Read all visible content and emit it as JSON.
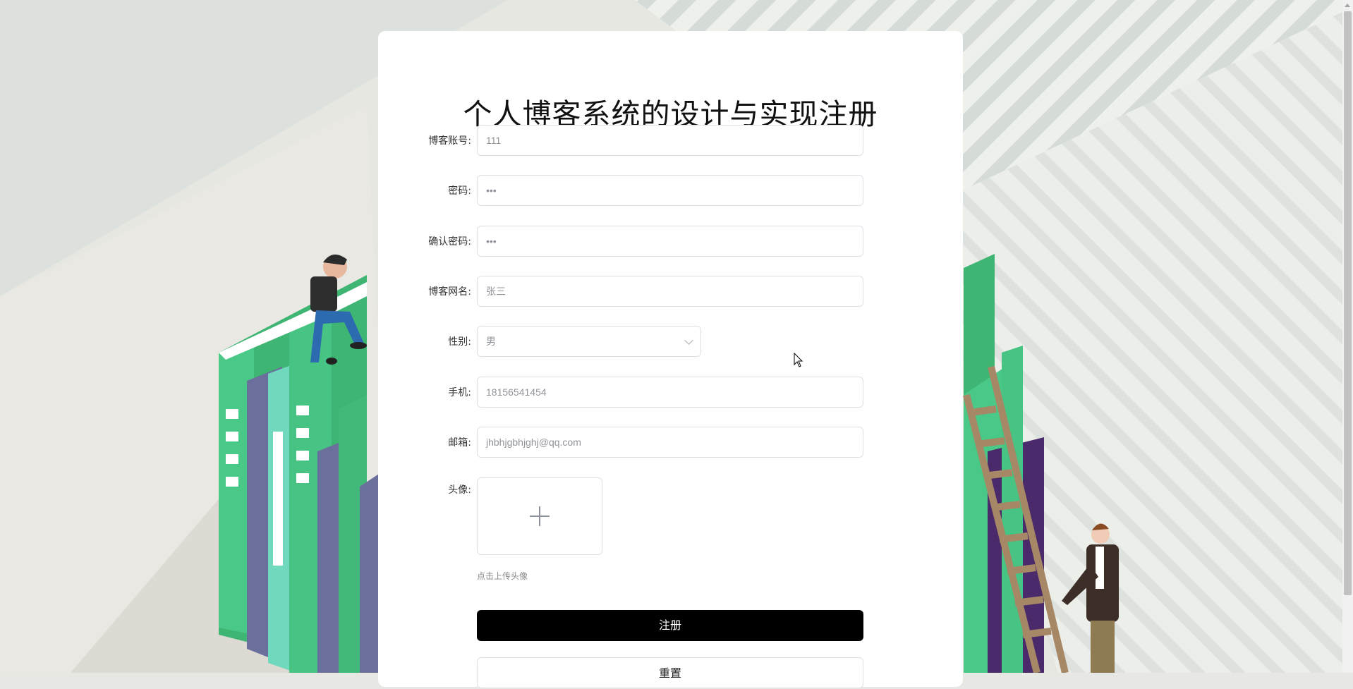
{
  "page": {
    "title": "个人博客系统的设计与实现注册"
  },
  "form": {
    "account": {
      "label": "博客账号:",
      "value": "111"
    },
    "password": {
      "label": "密码:",
      "value": "•••"
    },
    "confirm_password": {
      "label": "确认密码:",
      "value": "•••"
    },
    "nickname": {
      "label": "博客网名:",
      "value": "张三"
    },
    "gender": {
      "label": "性别:",
      "value": "男"
    },
    "phone": {
      "label": "手机:",
      "value": "18156541454"
    },
    "email": {
      "label": "邮箱:",
      "value": "jhbhjgbhjghj@qq.com"
    },
    "avatar": {
      "label": "头像:",
      "tip": "点击上传头像"
    },
    "register_button": "注册",
    "reset_button": "重置"
  },
  "icons": {
    "avatar_upload": "plus-icon",
    "gender_dropdown": "chevron-down-icon"
  },
  "colors": {
    "primary_button": "#000000",
    "card_background": "#ffffff"
  }
}
